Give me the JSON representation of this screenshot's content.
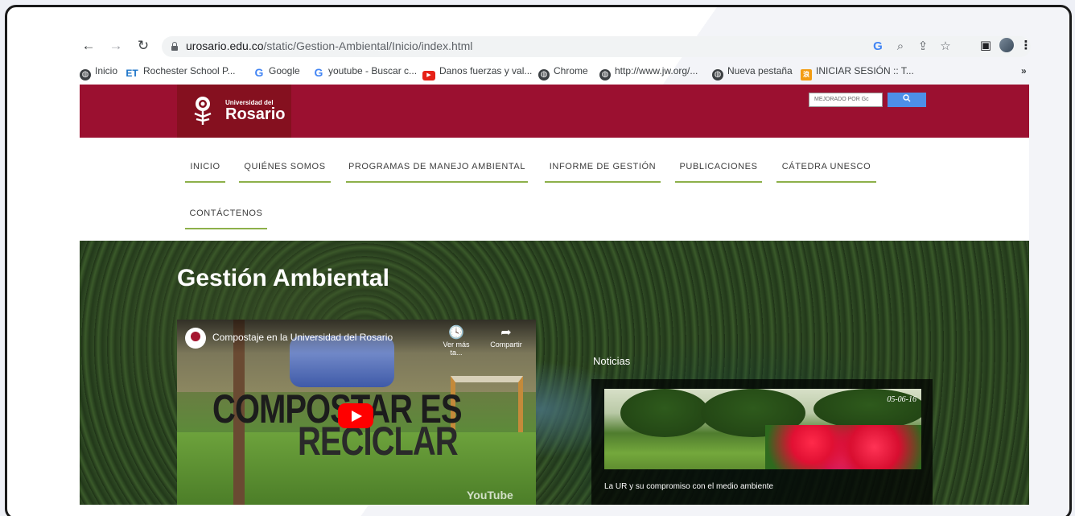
{
  "browser": {
    "url_host": "urosario.edu.co",
    "url_path": "/static/Gestion-Ambiental/Inicio/index.html",
    "bookmarks": [
      {
        "label": "Inicio",
        "icon": "globe-icon"
      },
      {
        "label": "Rochester School P...",
        "icon": "et-icon"
      },
      {
        "label": "Google",
        "icon": "google-icon"
      },
      {
        "label": "youtube - Buscar c...",
        "icon": "google-icon"
      },
      {
        "label": "Danos fuerzas y val...",
        "icon": "youtube-icon"
      },
      {
        "label": "Chrome",
        "icon": "globe-icon"
      },
      {
        "label": "http://www.jw.org/...",
        "icon": "globe-icon"
      },
      {
        "label": "Nueva pestaña",
        "icon": "globe-icon"
      },
      {
        "label": "INICIAR SESIÓN :: T...",
        "icon": "sina-icon"
      }
    ],
    "more": "»"
  },
  "site": {
    "logo_small": "Universidad del",
    "logo_big": "Rosario",
    "search_placeholder": "MEJORADO POR Gc",
    "search_button": "🔍",
    "nav": [
      "INICIO",
      "QUIÉNES SOMOS",
      "PROGRAMAS DE MANEJO AMBIENTAL",
      "INFORME DE GESTIÓN",
      "PUBLICACIONES",
      "CÁTEDRA UNESCO",
      "CONTÁCTENOS"
    ],
    "hero_title": "Gestión Ambiental",
    "video": {
      "title": "Compostaje en la Universidad del Rosario",
      "watch_later": "Ver más ta...",
      "share": "Compartir",
      "line1": "COMPOSTAR ES",
      "line2": "RECICLAR",
      "brand": "YouTube"
    },
    "news": {
      "label": "Noticias",
      "date": "05-06-16",
      "title": "La UR y su compromiso con el medio ambiente"
    }
  },
  "colors": {
    "header": "#9b1030",
    "nav_underline": "#8db04a",
    "search_button": "#4d8fe8"
  }
}
